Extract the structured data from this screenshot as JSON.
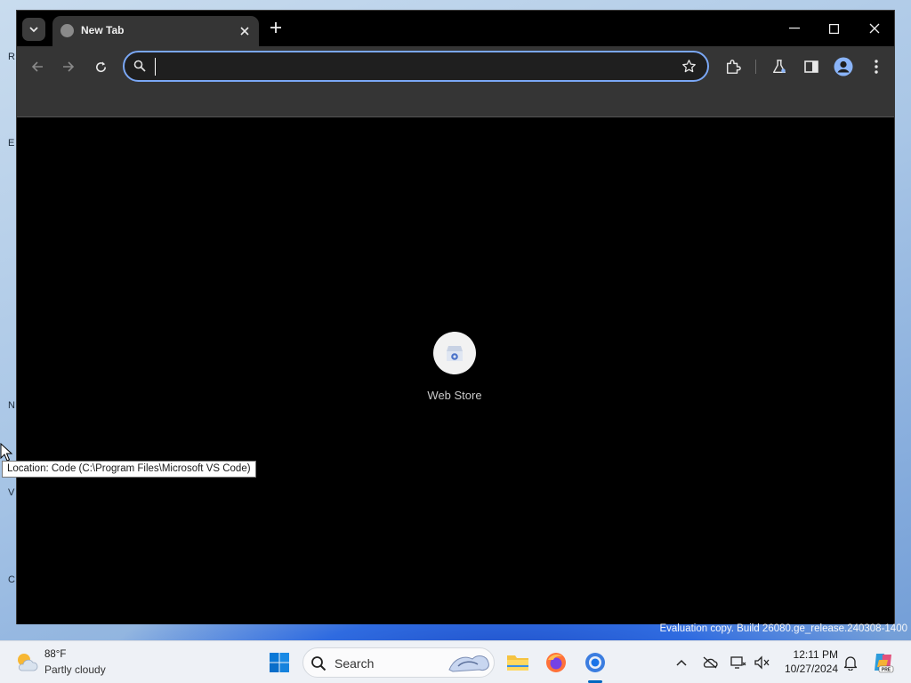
{
  "browser": {
    "tab": {
      "title": "New Tab"
    },
    "omnibox": {
      "value": "",
      "placeholder": ""
    }
  },
  "new_tab_page": {
    "shortcuts": [
      {
        "label": "Web Store",
        "icon": "web-store-icon"
      }
    ]
  },
  "tooltip": {
    "text": "Location: Code (C:\\Program Files\\Microsoft VS Code)"
  },
  "watermark": {
    "text": "Evaluation copy. Build 26080.ge_release.240308-1400"
  },
  "taskbar": {
    "weather": {
      "temp": "88°F",
      "desc": "Partly cloudy"
    },
    "search": {
      "label": "Search"
    },
    "clock": {
      "time": "12:11 PM",
      "date": "10/27/2024"
    }
  },
  "colors": {
    "accent": "#7aa7f5",
    "toolbar_bg": "#353535",
    "taskbar_bg": "#eef1f6",
    "profile_blue": "#8ab4f8"
  }
}
